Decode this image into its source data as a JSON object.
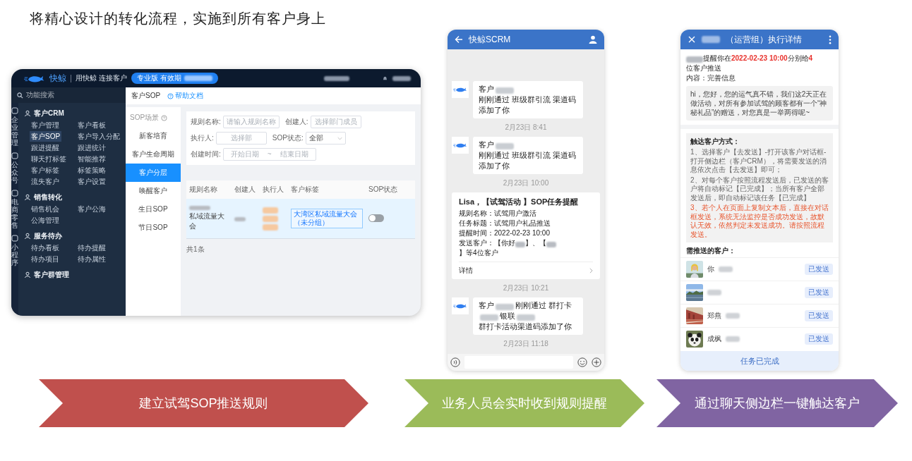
{
  "title": "将精心设计的转化流程，实施到所有客户身上",
  "web_app": {
    "logo": "快鲸",
    "slogan": "用快鲸 连接客户",
    "plan_badge": "专业版 有效期",
    "search": {
      "placeholder": "功能搜索"
    },
    "rail": [
      "企业管理",
      "公众号",
      "电商零售",
      "小程序"
    ],
    "menu": [
      {
        "title": "客户CRM",
        "items": [
          {
            "label": "客户管理",
            "selected": false
          },
          {
            "label": "客户看板",
            "selected": false
          },
          {
            "label": "客户SOP",
            "selected": true
          },
          {
            "label": "客户导入分配",
            "selected": false
          },
          {
            "label": "跟进提醒",
            "selected": false
          },
          {
            "label": "跟进统计",
            "selected": false
          },
          {
            "label": "聊天打标签",
            "selected": false
          },
          {
            "label": "智能推荐",
            "selected": false
          },
          {
            "label": "客户标签",
            "selected": false
          },
          {
            "label": "标签策略",
            "selected": false
          },
          {
            "label": "流失客户",
            "selected": false
          },
          {
            "label": "客户设置",
            "selected": false
          }
        ]
      },
      {
        "title": "销售转化",
        "items": [
          {
            "label": "销售机会",
            "selected": false
          },
          {
            "label": "客户公海",
            "selected": false
          },
          {
            "label": "公海管理",
            "selected": false
          }
        ]
      },
      {
        "title": "服务待办",
        "items": [
          {
            "label": "待办看板",
            "selected": false
          },
          {
            "label": "待办提醒",
            "selected": false
          },
          {
            "label": "待办项目",
            "selected": false
          },
          {
            "label": "待办属性",
            "selected": false
          }
        ]
      },
      {
        "title": "客户群管理"
      }
    ],
    "breadcrumb": "客户SOP",
    "help_link": "帮助文档",
    "scene_heading": "SOP场景",
    "scenes": [
      {
        "label": "新客培育",
        "selected": false
      },
      {
        "label": "客户生命周期",
        "selected": false
      },
      {
        "label": "客户分层",
        "selected": true
      },
      {
        "label": "唤醒客户",
        "selected": false
      },
      {
        "label": "生日SOP",
        "selected": false
      },
      {
        "label": "节日SOP",
        "selected": false
      }
    ],
    "filters": [
      {
        "kind": "input",
        "label": "规则名称:",
        "placeholder": "请输入规则名称"
      },
      {
        "kind": "picker",
        "label": "创建人:",
        "placeholder": "选择部门成员"
      },
      {
        "kind": "picker",
        "label": "执行人:",
        "placeholder": "选择部"
      },
      {
        "kind": "select",
        "label": "SOP状态:",
        "value": "全部"
      },
      {
        "kind": "daterange",
        "label": "创建时间:",
        "start_placeholder": "开始日期",
        "separator": "~",
        "end_placeholder": "结束日期"
      }
    ],
    "table": {
      "columns": [
        "规则名称",
        "创建人",
        "执行人",
        "客户标签",
        "SOP状态"
      ],
      "rows": [
        {
          "rule_name": "私域流量大会",
          "tag": "大湾区私域流量大会（未分组）",
          "on": false
        }
      ]
    },
    "total": "共1条"
  },
  "chat": {
    "title": "快鲸SCRM",
    "items": [
      {
        "kind": "message",
        "segments": [
          "客户",
          "刚刚通过 班级群引流 渠道码添加了你"
        ]
      },
      {
        "kind": "time",
        "text": "2月23日 8:41"
      },
      {
        "kind": "message",
        "segments": [
          "客户",
          "刚刚通过 班级群引流 渠道码添加了你"
        ]
      },
      {
        "kind": "time",
        "text": "2月23日 10:00"
      },
      {
        "kind": "card",
        "title": "Lisa，【试驾活动 】SOP任务提醒",
        "fields": [
          {
            "label": "规则名称：",
            "segments": [
              "试驾用户激活"
            ]
          },
          {
            "label": "任务标题：",
            "segments": [
              "试驾用户礼品推送"
            ]
          },
          {
            "label": "提醒时间：",
            "segments": [
              "2022-02-23 10:00"
            ]
          },
          {
            "label": "发送客户：",
            "segments": [
              "【你好",
              "】、【",
              "】等4位客户"
            ]
          }
        ],
        "link": "详情"
      },
      {
        "kind": "time",
        "text": "2月23日 10:21"
      },
      {
        "kind": "message",
        "segments": [
          "客户",
          "刚刚通过 群打卡",
          "银联",
          "群打卡活动渠道码添加了你"
        ]
      },
      {
        "kind": "time",
        "text": "2月23日 11:18"
      }
    ]
  },
  "task": {
    "title": "（运营组）执行详情",
    "reminder": [
      {
        "text": "提醒你在 ",
        "highlight": false
      },
      {
        "text": "2022-02-23 10:00",
        "highlight": true
      },
      {
        "text": " 分别给",
        "highlight": false
      },
      {
        "text": "4",
        "highlight": true
      },
      {
        "text": "位客户推送",
        "highlight": false
      }
    ],
    "content_label": "内容：完善信息",
    "message": "hi，您好，您的运气真不错，我们这2天正在做活动，对所有参加试驾的顾客都有一个“神秘礼品”的赠送，对您真是一举两得呢~",
    "method_title": "触达客户方式：",
    "steps": [
      {
        "text": "1、选择客户【去发送】-打开该客户对话框-打开侧边栏（客户CRM），将需要发送的消息依次点击【去发送】即可；",
        "warning": false
      },
      {
        "text": "2、对每个客户按照流程发送后，已发送的客户将自动标记【已完成】；当所有客户全部发送后，即自动标记该任务【已完成】",
        "warning": false
      },
      {
        "text": "3、若个人在页面上复制文本后，直接在对话框发送，系统无法监控是否成功发送，故默认无效，依然判定未发送成功。请按照流程发送。",
        "warning": true
      }
    ],
    "customers_title": "需推送的客户：",
    "customers": [
      {
        "name": "你",
        "status": "已发送"
      },
      {
        "status": "已发送"
      },
      {
        "name": "郑燕",
        "status": "已发送"
      },
      {
        "name": "成枫",
        "status": "已发送"
      }
    ],
    "footer_button": "任务已完成"
  },
  "arrows": [
    {
      "label": "建立试驾SOP推送规则",
      "color": "#c0504d"
    },
    {
      "label": "业务人员会实时收到规则提醒",
      "color": "#9bbb59"
    },
    {
      "label": "通过聊天侧边栏一键触达客户",
      "color": "#8064a2"
    }
  ]
}
